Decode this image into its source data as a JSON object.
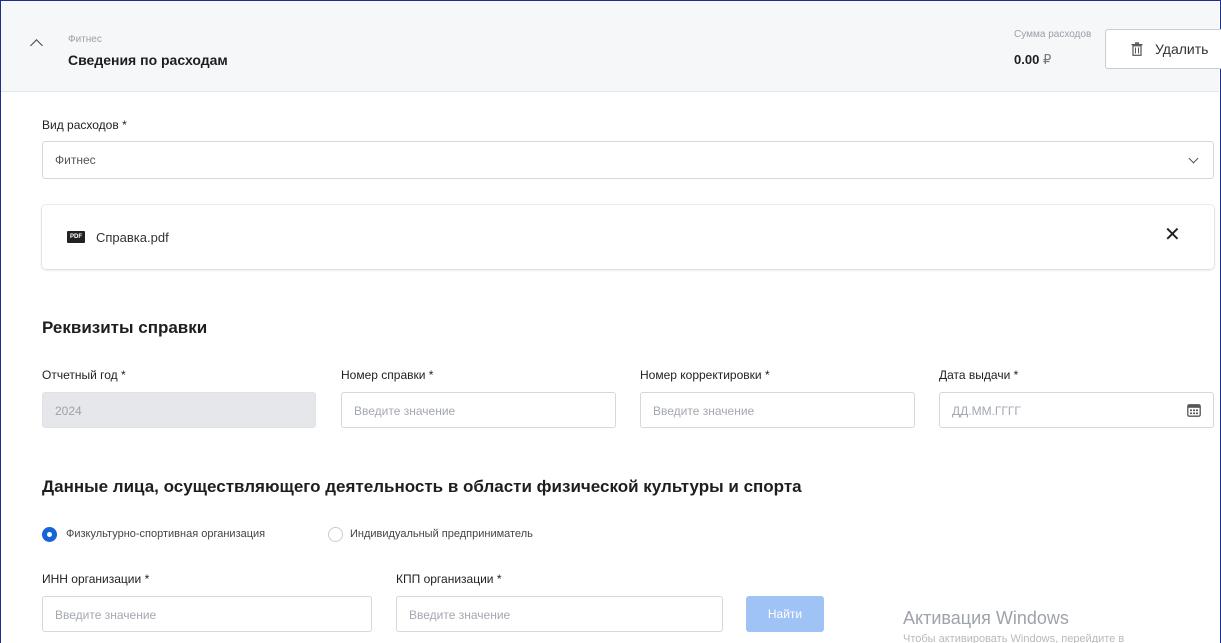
{
  "header": {
    "category": "Фитнес",
    "title": "Сведения по расходам",
    "sum_label": "Сумма расходов",
    "sum_value": "0.00",
    "currency": "₽",
    "delete_label": "Удалить"
  },
  "expense_type": {
    "label": "Вид расходов",
    "required": "*",
    "value": "Фитнес"
  },
  "file": {
    "icon_text": "PDF",
    "name": "Справка.pdf"
  },
  "requisites": {
    "title": "Реквизиты справки",
    "year": {
      "label": "Отчетный год",
      "required": "*",
      "value": "2024"
    },
    "cert_number": {
      "label": "Номер справки",
      "required": "*",
      "placeholder": "Введите значение"
    },
    "correction_number": {
      "label": "Номер корректировки",
      "required": "*",
      "placeholder": "Введите значение"
    },
    "issue_date": {
      "label": "Дата выдачи",
      "required": "*",
      "placeholder": "ДД.ММ.ГГГГ"
    }
  },
  "provider": {
    "title": "Данные лица, осуществляющего деятельность в области физической культуры и спорта",
    "options": [
      "Физкультурно-спортивная организация",
      "Индивидуальный предприниматель"
    ],
    "selected_index": 0,
    "inn": {
      "label": "ИНН организации",
      "required": "*",
      "placeholder": "Введите значение"
    },
    "kpp": {
      "label": "КПП организации",
      "required": "*",
      "placeholder": "Введите значение"
    },
    "find_label": "Найти"
  },
  "watermark": {
    "line1": "Активация Windows",
    "line2": "Чтобы активировать Windows, перейдите в"
  },
  "colors": {
    "accent": "#1565d8",
    "find_button": "#9fc3f5",
    "header_bg": "#f6f7f9",
    "frame": "#1b2f8c"
  }
}
